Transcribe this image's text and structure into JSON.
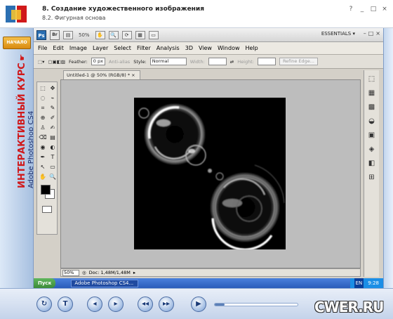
{
  "frame": {
    "title": "8. Создание художественного изображения",
    "subtitle": "8.2. Фигурная основа",
    "window_buttons": [
      "?",
      "_",
      "□",
      "×"
    ],
    "start_label": "НАЧАЛО",
    "course_title": "ИНТЕРАКТИВНЫЙ КУРС",
    "course_subtitle": "Adobe Photoshop CS4",
    "nav_buttons": [
      "↻",
      "T",
      "◂",
      "▸",
      "◂◂",
      "▸▸",
      "▶"
    ],
    "playback_progress": 0.12,
    "watermark": "CWER.RU"
  },
  "ps": {
    "zoom": "50%",
    "workspace": "ESSENTIALS ▾",
    "menu": [
      "File",
      "Edit",
      "Image",
      "Layer",
      "Select",
      "Filter",
      "Analysis",
      "3D",
      "View",
      "Window",
      "Help"
    ],
    "options": {
      "feather_label": "Feather:",
      "feather_value": "0 px",
      "antialias": "Anti-alias",
      "style_label": "Style:",
      "style_value": "Normal",
      "width_label": "Width:",
      "height_label": "Height:",
      "refine": "Refine Edge..."
    },
    "doc_tab": "Untitled-1 @ 50% (RGB/8) * ×",
    "status_zoom": "50%",
    "status_doc": "Doc: 1,48M/1,48M",
    "tools": [
      "⬚",
      "✥",
      "◌",
      "⌁",
      "⌗",
      "✎",
      "⊕",
      "✐",
      "♙",
      "✍",
      "⌫",
      "▤",
      "◉",
      "◐",
      "✒",
      "T",
      "↖",
      "▭",
      "✋",
      "🔍"
    ],
    "panel_icons": [
      "⬚",
      "▦",
      "▩",
      "◒",
      "▣",
      "◈",
      "◧",
      "⊞"
    ]
  },
  "taskbar": {
    "start": "Пуск",
    "app": "Adobe Photoshop CS4...",
    "lang": "EN",
    "time": "9:28"
  }
}
